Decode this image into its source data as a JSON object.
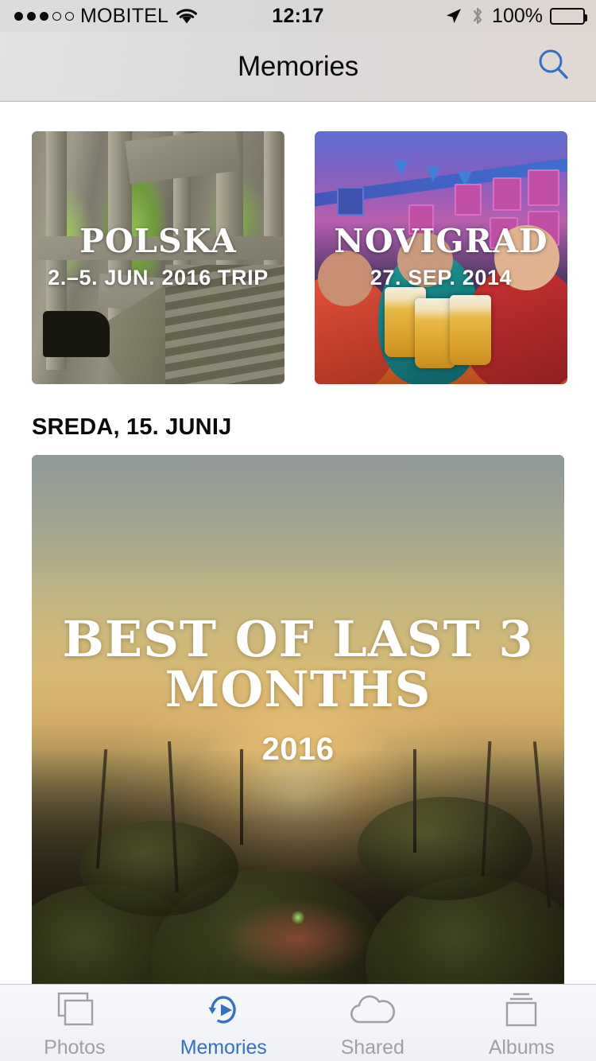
{
  "status_bar": {
    "signal_dots_filled": 3,
    "signal_dots_total": 5,
    "carrier": "MOBITEL",
    "wifi_icon": "wifi-icon",
    "time": "12:17",
    "location_icon": "location-arrow-icon",
    "bluetooth_icon": "bluetooth-icon",
    "battery_percent": "100%",
    "battery_level": 100
  },
  "nav_bar": {
    "title": "Memories",
    "search_icon": "search-icon"
  },
  "memories": {
    "top_row": [
      {
        "title": "POLSKA",
        "subtitle": "2.–5. JUN. 2016 TRIP"
      },
      {
        "title": "NOVIGRAD",
        "subtitle": "27. SEP. 2014"
      }
    ],
    "section_header": "SREDA, 15. JUNIJ",
    "featured": {
      "title": "BEST OF LAST 3 MONTHS",
      "subtitle": "2016"
    }
  },
  "tab_bar": {
    "active_color": "#3470c6",
    "inactive_color": "#a0a0a5",
    "tabs": [
      {
        "label": "Photos",
        "icon": "photos-stack-icon",
        "active": false
      },
      {
        "label": "Memories",
        "icon": "memories-play-circle-icon",
        "active": true
      },
      {
        "label": "Shared",
        "icon": "cloud-icon",
        "active": false
      },
      {
        "label": "Albums",
        "icon": "albums-stack-icon",
        "active": false
      }
    ]
  }
}
